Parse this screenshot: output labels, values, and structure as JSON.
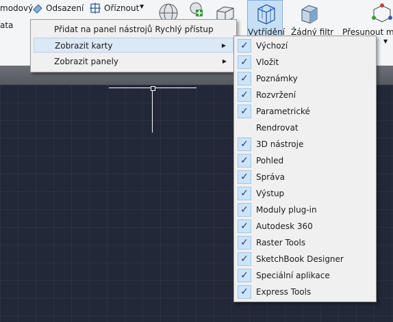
{
  "ribbon": {
    "text_modovy": "modový",
    "text_ata": "ata",
    "odsazeni": "Odsazení",
    "oriznout": "Oříznout",
    "vytrideni": "Vytřídění",
    "zadny_filtr": "Žádný filtr",
    "presunout": "Přesunout ma"
  },
  "context_menu": {
    "items": [
      {
        "label": "Přidat na panel nástrojů Rychlý přístup"
      },
      {
        "label": "Zobrazit karty"
      },
      {
        "label": "Zobrazit panely"
      }
    ]
  },
  "submenu": {
    "items": [
      {
        "label": "Výchozí",
        "checked": true
      },
      {
        "label": "Vložit",
        "checked": true
      },
      {
        "label": "Poznámky",
        "checked": true
      },
      {
        "label": "Rozvržení",
        "checked": true
      },
      {
        "label": "Parametrické",
        "checked": true
      },
      {
        "label": "Rendrovat",
        "checked": false
      },
      {
        "label": "3D nástroje",
        "checked": true
      },
      {
        "label": "Pohled",
        "checked": true
      },
      {
        "label": "Správa",
        "checked": true
      },
      {
        "label": "Výstup",
        "checked": true
      },
      {
        "label": "Moduly plug-in",
        "checked": true
      },
      {
        "label": "Autodesk 360",
        "checked": true
      },
      {
        "label": "Raster Tools",
        "checked": true
      },
      {
        "label": "SketchBook Designer",
        "checked": true
      },
      {
        "label": "Speciální aplikace",
        "checked": true
      },
      {
        "label": "Express Tools",
        "checked": true
      }
    ]
  }
}
